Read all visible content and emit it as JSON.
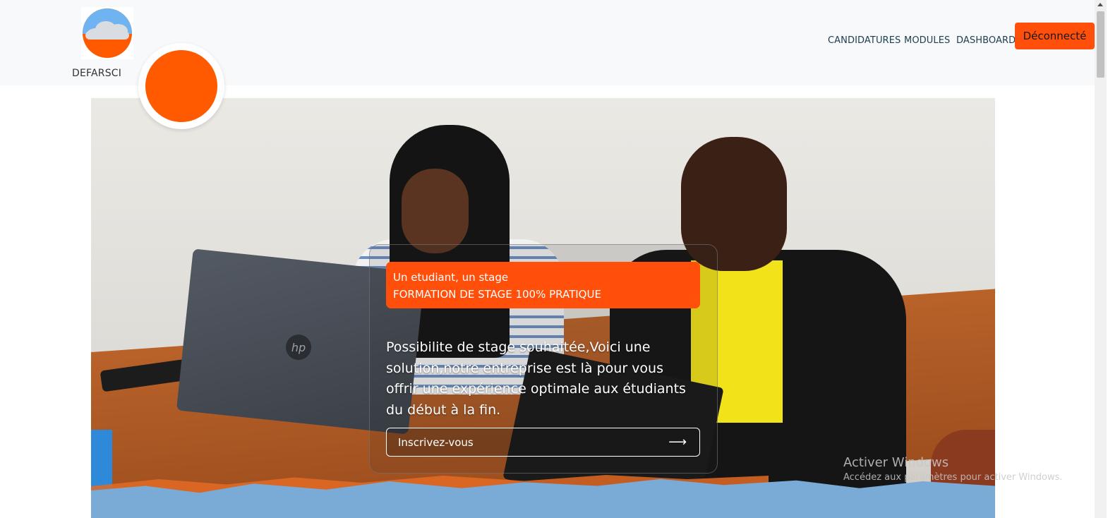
{
  "header": {
    "brand": "DEFARSCI",
    "logo_icon": "cloud-logo-icon",
    "nav": [
      {
        "label": "CANDIDATURES"
      },
      {
        "label": "MODULES"
      },
      {
        "label": "DASHBOARD"
      }
    ],
    "logout_label": "Déconnecté"
  },
  "hero": {
    "tag_line1": "Un etudiant, un stage",
    "tag_line2": "FORMATION DE STAGE 100% PRATIQUE",
    "lead": "Possibilite de stage souhaitée,Voici une solution,notre entreprise est là pour vous offrir une expérience optimale aux étudiants du début à la fin.",
    "cta_label": "Inscrivez-vous",
    "cta_icon": "arrow-right-icon"
  },
  "watermark": {
    "title": "Activer Windows",
    "subtitle": "Accédez aux paramètres pour activer Windows."
  },
  "colors": {
    "accent": "#ff4f0a",
    "nav_text": "#1c3d50",
    "header_bg": "#f8f9fa"
  }
}
